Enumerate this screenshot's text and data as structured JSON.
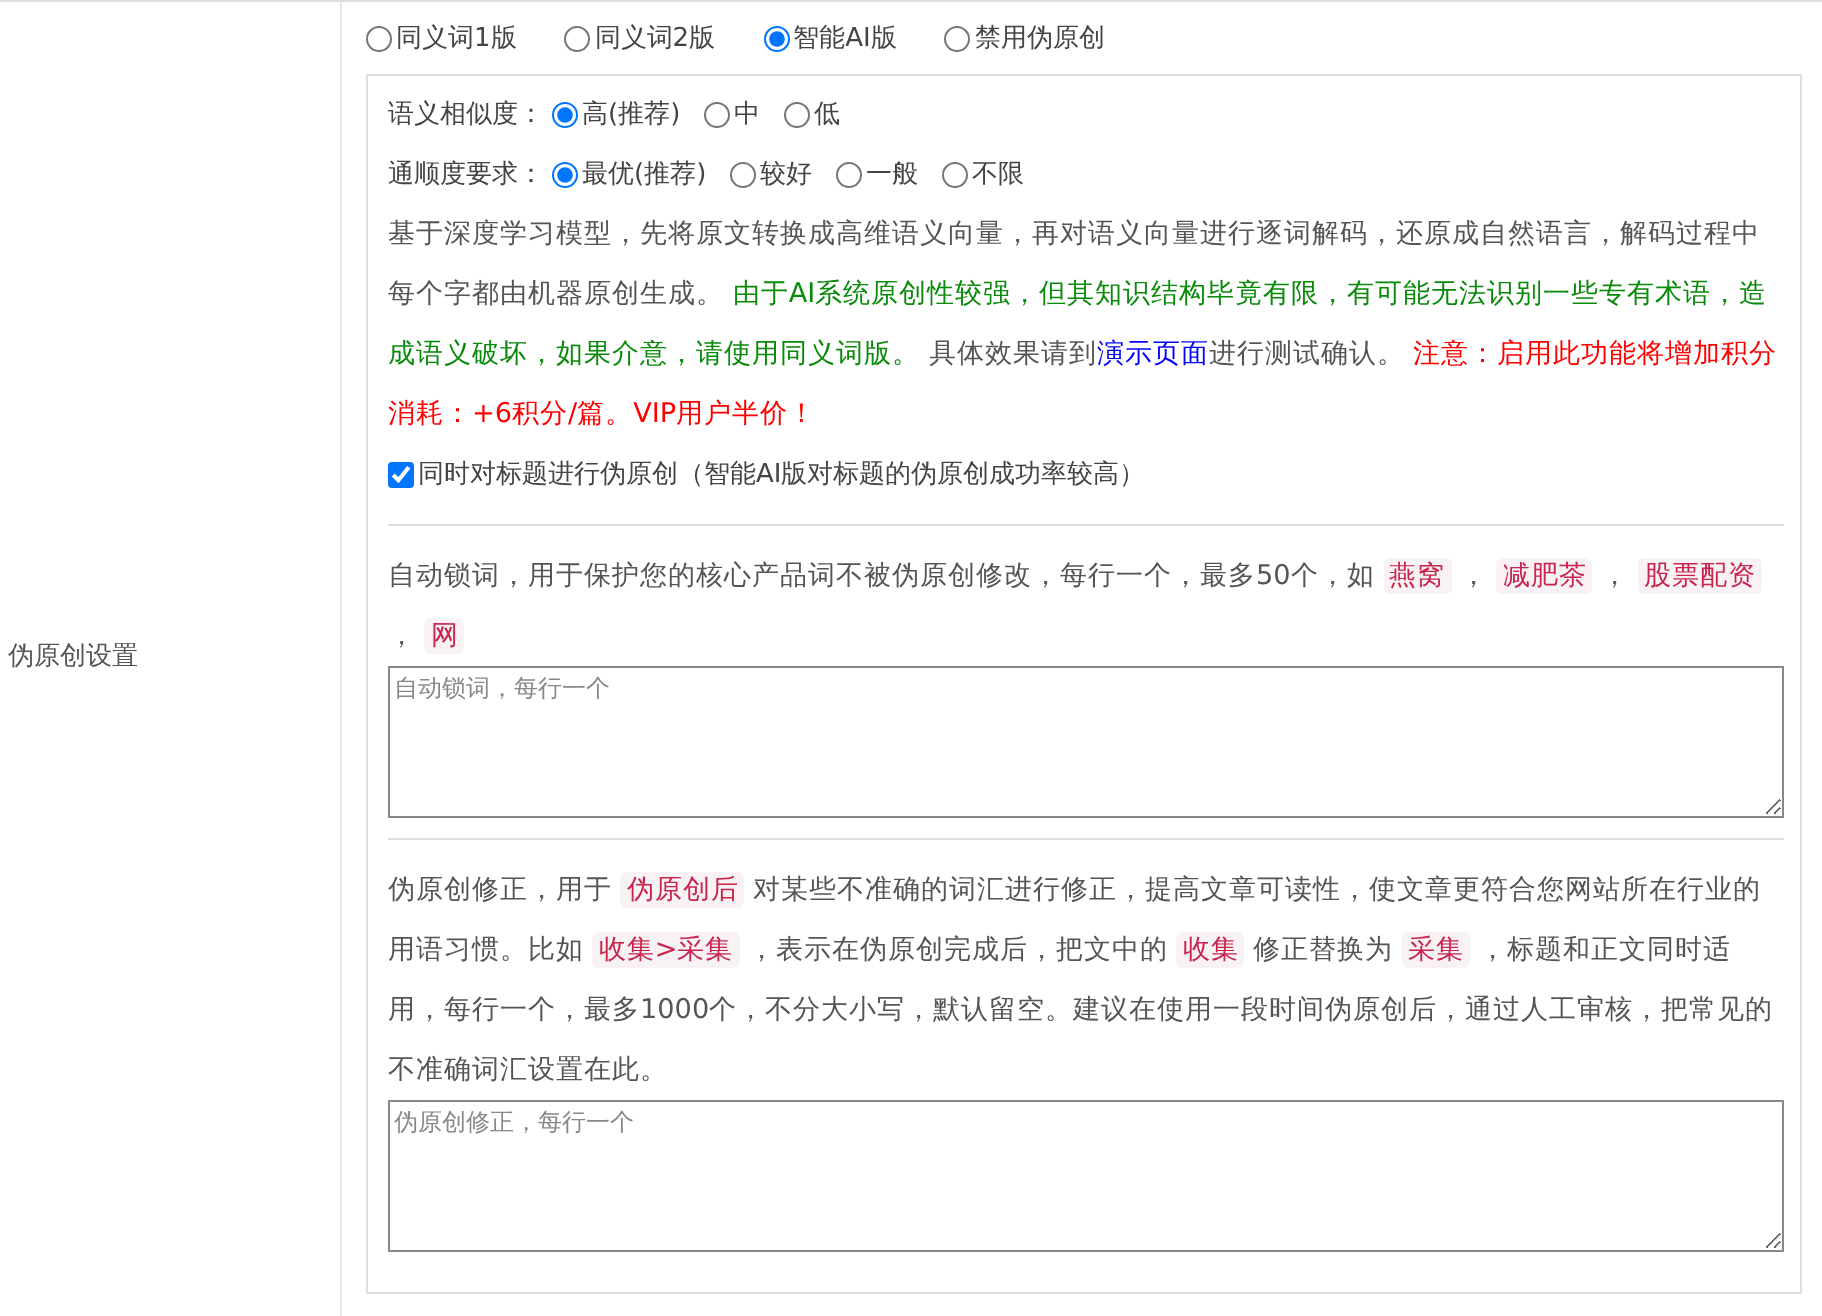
{
  "mode_options": [
    {
      "label": "同义词1版",
      "selected": false
    },
    {
      "label": "同义词2版",
      "selected": false
    },
    {
      "label": "智能AI版",
      "selected": true
    },
    {
      "label": "禁用伪原创",
      "selected": false
    }
  ],
  "similarity": {
    "label": "语义相似度：",
    "options": [
      {
        "label": "高(推荐)",
        "selected": true
      },
      {
        "label": "中",
        "selected": false
      },
      {
        "label": "低",
        "selected": false
      }
    ]
  },
  "fluency": {
    "label": "通顺度要求：",
    "options": [
      {
        "label": "最优(推荐)",
        "selected": true
      },
      {
        "label": "较好",
        "selected": false
      },
      {
        "label": "一般",
        "selected": false
      },
      {
        "label": "不限",
        "selected": false
      }
    ]
  },
  "description": [
    {
      "kind": "plain",
      "text": "基于深度学习模型，先将原文转换成高维语义向量，再对语义向量进行逐词解码，还原成自然语言，解码过程中每个字都由机器原创生成。 "
    },
    {
      "kind": "green",
      "text": "由于AI系统原创性较强，但其知识结构毕竟有限，有可能无法识别一些专有术语，造成语义破坏，如果介意，请使用同义词版。"
    },
    {
      "kind": "plain",
      "text": " 具体效果请到"
    },
    {
      "kind": "link",
      "text": "演示页面"
    },
    {
      "kind": "plain",
      "text": "进行测试确认。 "
    },
    {
      "kind": "red",
      "text": "注意：启用此功能将增加积分消耗：+6积分/篇。VIP用户半价！"
    }
  ],
  "title_checkbox": {
    "label": "同时对标题进行伪原创（智能AI版对标题的伪原创成功率较高）",
    "checked": true
  },
  "section_label": "伪原创设置",
  "lock_words": {
    "text": [
      {
        "kind": "plain",
        "text": "自动锁词，用于保护您的核心产品词不被伪原创修改，每行一个，最多50个，如 "
      },
      {
        "kind": "code",
        "text": "燕窝"
      },
      {
        "kind": "plain",
        "text": " ， "
      },
      {
        "kind": "code",
        "text": "减肥茶"
      },
      {
        "kind": "plain",
        "text": " ， "
      },
      {
        "kind": "code",
        "text": "股票配资"
      },
      {
        "kind": "plain",
        "text": " ， "
      },
      {
        "kind": "code",
        "text": "网"
      }
    ],
    "placeholder": "自动锁词，每行一个"
  },
  "correction": {
    "text": [
      {
        "kind": "plain",
        "text": "伪原创修正，用于 "
      },
      {
        "kind": "code",
        "text": "伪原创后"
      },
      {
        "kind": "plain",
        "text": " 对某些不准确的词汇进行修正，提高文章可读性，使文章更符合您网站所在行业的用语习惯。比如 "
      },
      {
        "kind": "code",
        "text": "收集>采集"
      },
      {
        "kind": "plain",
        "text": " ，表示在伪原创完成后，把文中的 "
      },
      {
        "kind": "code",
        "text": "收集"
      },
      {
        "kind": "plain",
        "text": " 修正替换为 "
      },
      {
        "kind": "code",
        "text": "采集"
      },
      {
        "kind": "plain",
        "text": " ，标题和正文同时适用，每行一个，最多1000个，不分大小写，默认留空。建议在使用一段时间伪原创后，通过人工审核，把常见的不准确词汇设置在此。"
      }
    ],
    "placeholder": "伪原创修正，每行一个"
  }
}
